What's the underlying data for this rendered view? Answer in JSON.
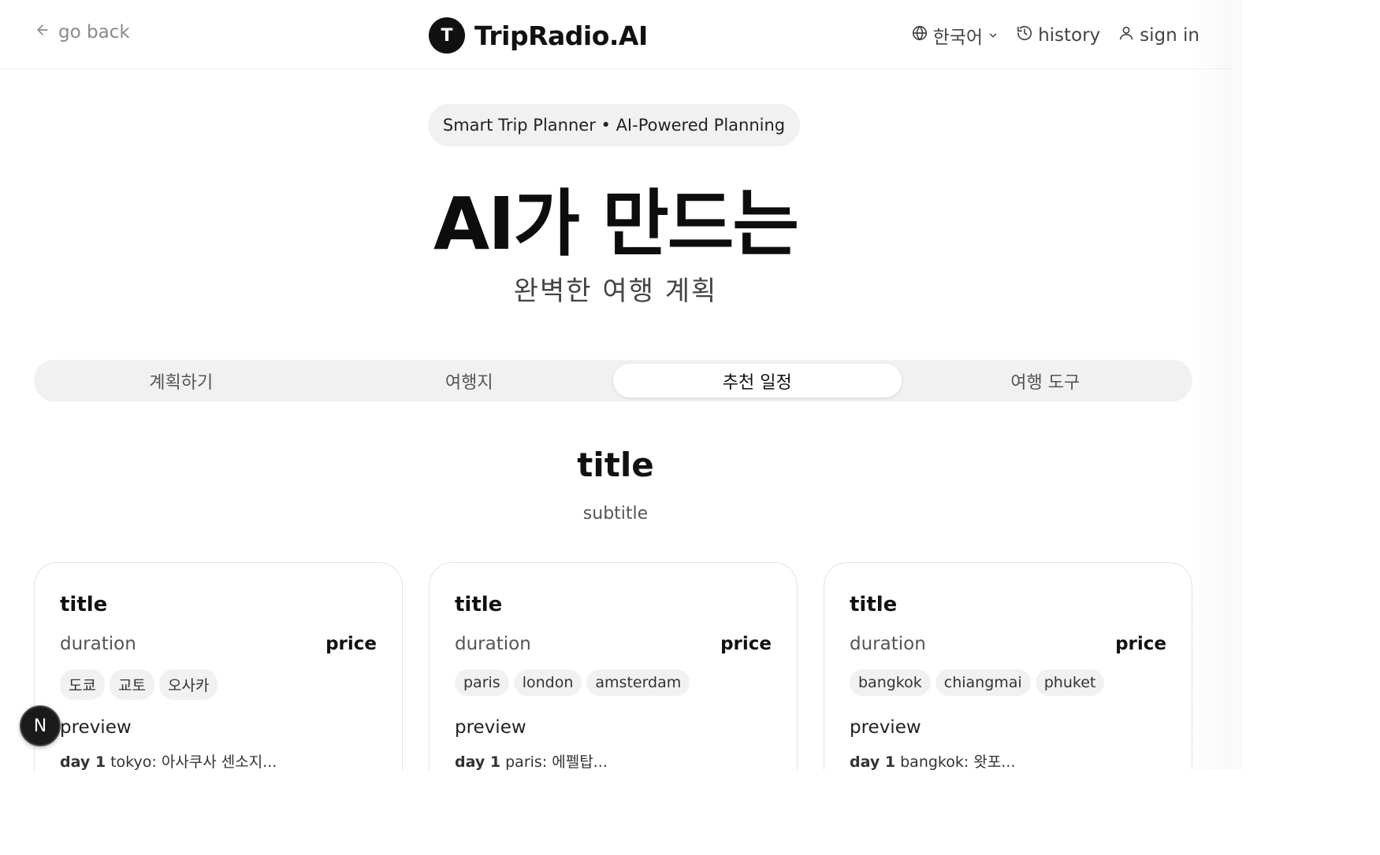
{
  "header": {
    "back_label": "go back",
    "brand_mark": "T",
    "brand_name": "TripRadio.AI",
    "language": "한국어",
    "history": "history",
    "sign_in": "sign in"
  },
  "hero": {
    "pill": "Smart Trip Planner • AI-Powered Planning",
    "title": "AI가 만드는",
    "subtitle": "완벽한 여행 계획"
  },
  "tabs": [
    {
      "label": "계획하기",
      "active": false
    },
    {
      "label": "여행지",
      "active": false
    },
    {
      "label": "추천 일정",
      "active": true
    },
    {
      "label": "여행 도구",
      "active": false
    }
  ],
  "section": {
    "title": "title",
    "subtitle": "subtitle"
  },
  "cards": [
    {
      "title": "title",
      "duration": "duration",
      "price": "price",
      "tags": [
        "도쿄",
        "교토",
        "오사카"
      ],
      "preview": "preview",
      "day_label": "day 1",
      "day_text": "tokyo: 아사쿠사 센소지..."
    },
    {
      "title": "title",
      "duration": "duration",
      "price": "price",
      "tags": [
        "paris",
        "london",
        "amsterdam"
      ],
      "preview": "preview",
      "day_label": "day 1",
      "day_text": "paris: 에펠탑..."
    },
    {
      "title": "title",
      "duration": "duration",
      "price": "price",
      "tags": [
        "bangkok",
        "chiangmai",
        "phuket"
      ],
      "preview": "preview",
      "day_label": "day 1",
      "day_text": "bangkok: 왓포..."
    }
  ],
  "fab_label": "N"
}
